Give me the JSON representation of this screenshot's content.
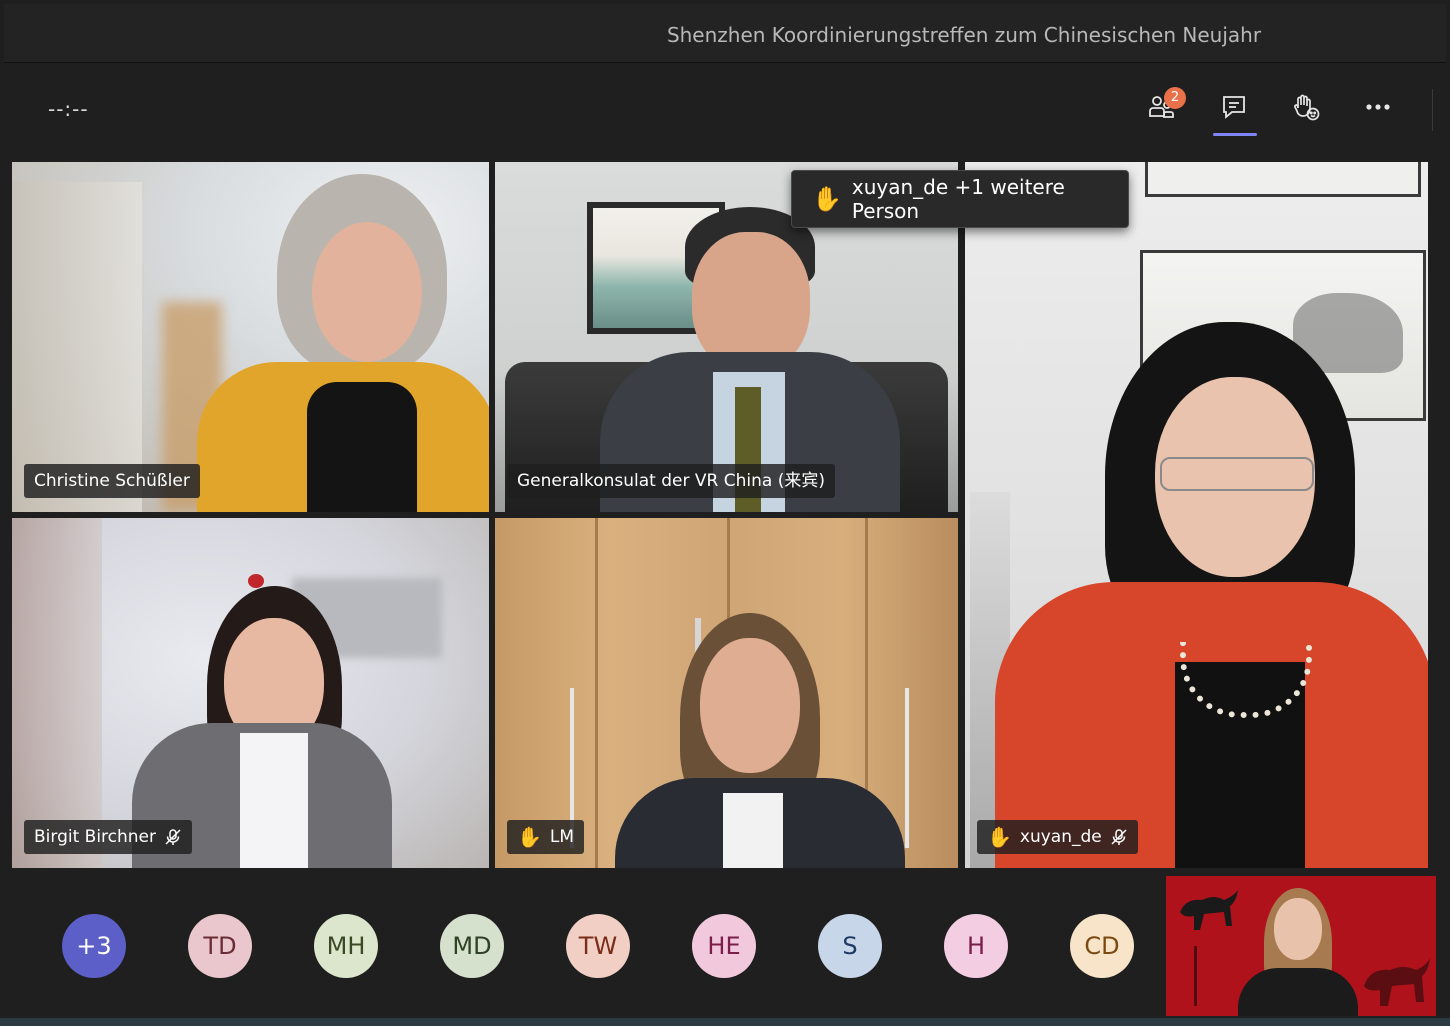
{
  "meeting": {
    "title": "Shenzhen Koordinierungstreffen zum Chinesischen Neujahr",
    "timer": "--:--"
  },
  "toolbar": {
    "people_icon": "people-icon",
    "people_count": "2",
    "chat_icon": "chat-icon",
    "reactions_icon": "raise-hand-icon",
    "more_icon": "more-options-icon"
  },
  "tooltip": {
    "hand_icon": "raised-hand-icon",
    "text": "xuyan_de +1 weitere Person"
  },
  "participants": [
    {
      "name": "Christine Schüßler",
      "hand_raised": false,
      "muted": false
    },
    {
      "name": "Generalkonsulat der VR China (来宾)",
      "hand_raised": false,
      "muted": false
    },
    {
      "name": "Birgit Birchner",
      "hand_raised": false,
      "muted": true
    },
    {
      "name": "LM",
      "hand_raised": true,
      "muted": false
    },
    {
      "name": "xuyan_de",
      "hand_raised": true,
      "muted": true
    }
  ],
  "roster": [
    {
      "initials": "+3",
      "bg": "#5b5fc7",
      "fg": "#ffffff"
    },
    {
      "initials": "TD",
      "bg": "#e9c7cc",
      "fg": "#6b2c36"
    },
    {
      "initials": "MH",
      "bg": "#dce6cc",
      "fg": "#3b4a24"
    },
    {
      "initials": "MD",
      "bg": "#d5e0cd",
      "fg": "#2f4226"
    },
    {
      "initials": "TW",
      "bg": "#f1cfc4",
      "fg": "#7a2e1a"
    },
    {
      "initials": "HE",
      "bg": "#f2c9dc",
      "fg": "#7a1f4a"
    },
    {
      "initials": "S",
      "bg": "#c8d6ea",
      "fg": "#1f3a66"
    },
    {
      "initials": "H",
      "bg": "#f3cde2",
      "fg": "#7a1d4d"
    },
    {
      "initials": "CD",
      "bg": "#f8e4c8",
      "fg": "#7a4a12"
    }
  ],
  "colors": {
    "accent": "#7f85f5",
    "badge": "#e8714a",
    "hand": "#f1b232"
  }
}
